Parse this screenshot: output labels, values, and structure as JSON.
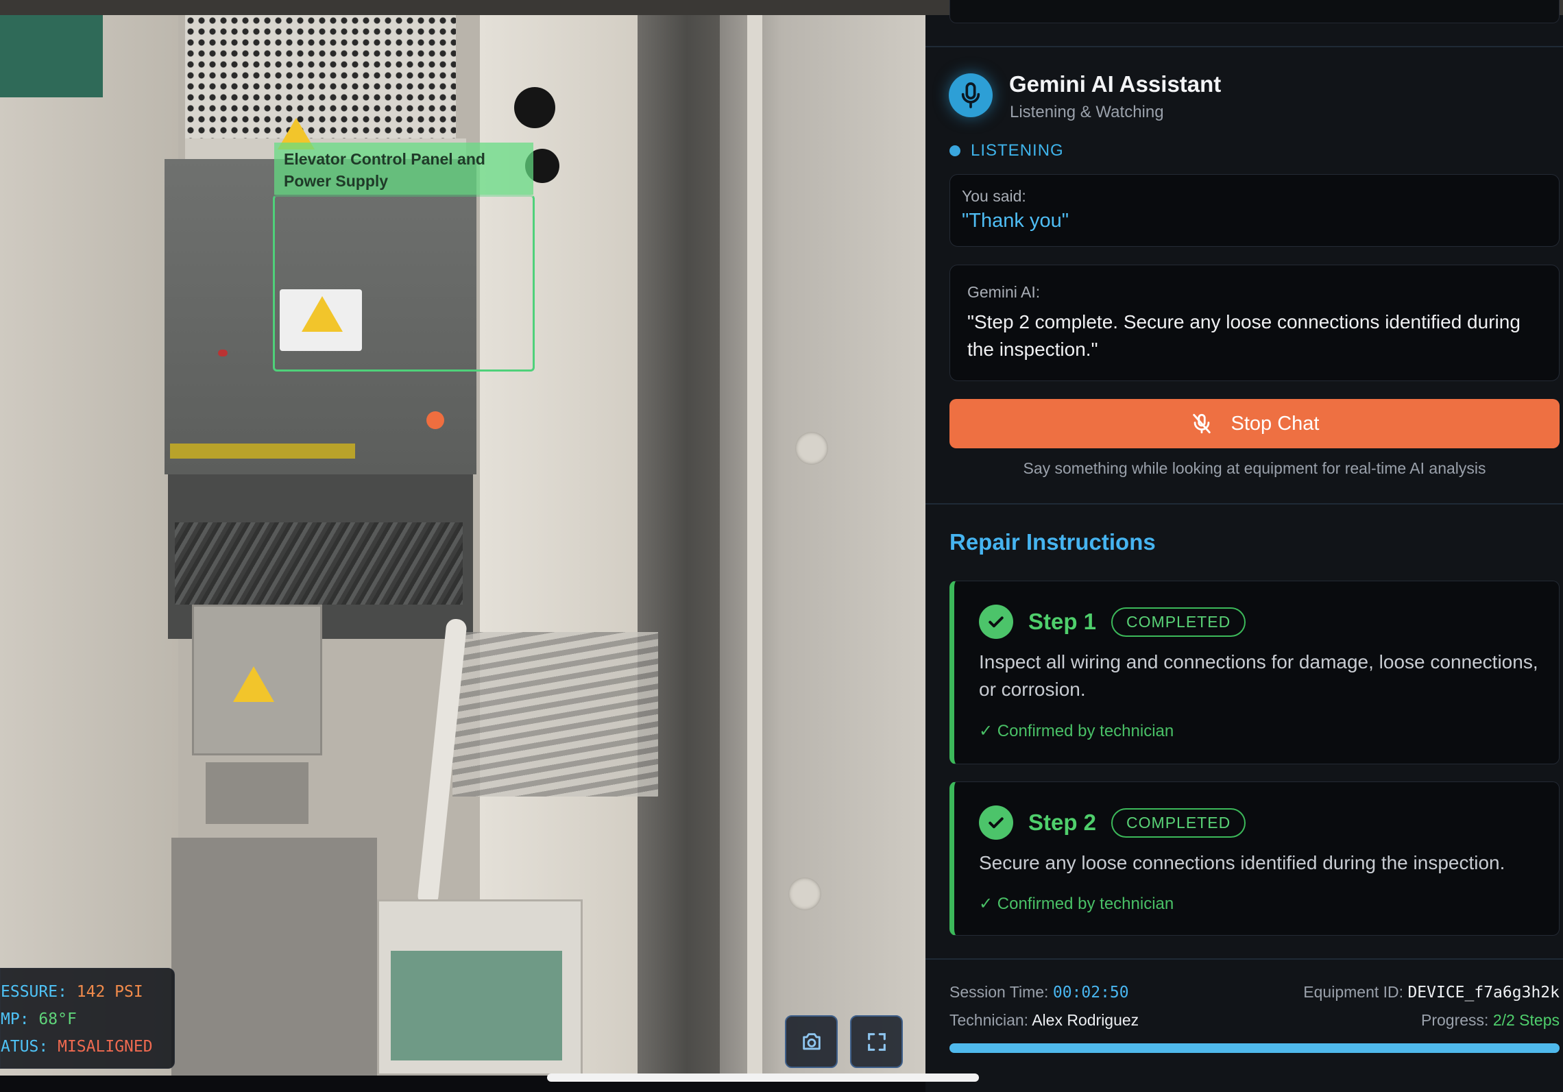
{
  "camera": {
    "ar_label": "Elevator Control Panel and Power Supply",
    "hud": [
      {
        "key": "ESSURE:",
        "value": "142 PSI",
        "tone": "orange"
      },
      {
        "key": "MP:",
        "value": "68°F",
        "tone": "green"
      },
      {
        "key": "ATUS:",
        "value": "MISALIGNED",
        "tone": "red"
      }
    ],
    "controls": [
      {
        "icon": "camera-icon"
      },
      {
        "icon": "fullscreen-icon"
      }
    ]
  },
  "assistant": {
    "title": "Gemini AI Assistant",
    "subtitle": "Listening & Watching",
    "status": "LISTENING",
    "you_said_label": "You said:",
    "you_said_text": "\"Thank you\"",
    "ai_label": "Gemini AI:",
    "ai_text": "\"Step 2 complete. Secure any loose connections identified during the inspection.\"",
    "stop_button": "Stop Chat",
    "hint": "Say something while looking at equipment for real-time AI analysis"
  },
  "repair": {
    "title": "Repair Instructions",
    "steps": [
      {
        "title": "Step 1",
        "badge": "COMPLETED",
        "description": "Inspect all wiring and connections for damage, loose connections, or corrosion.",
        "confirmation": "✓ Confirmed by technician"
      },
      {
        "title": "Step 2",
        "badge": "COMPLETED",
        "description": "Secure any loose connections identified during the inspection.",
        "confirmation": "✓ Confirmed by technician"
      }
    ]
  },
  "session": {
    "time_label": "Session Time:",
    "time_value": "00:02:50",
    "equipment_label": "Equipment ID:",
    "equipment_value": "DEVICE_f7a6g3h2k",
    "technician_label": "Technician:",
    "technician_value": "Alex Rodriguez",
    "progress_label": "Progress:",
    "progress_value": "2/2 Steps",
    "progress_fraction": 1.0
  },
  "colors": {
    "accent_blue": "#46b4f0",
    "stop_orange": "#ee7042",
    "complete_green": "#4fcf6c"
  }
}
